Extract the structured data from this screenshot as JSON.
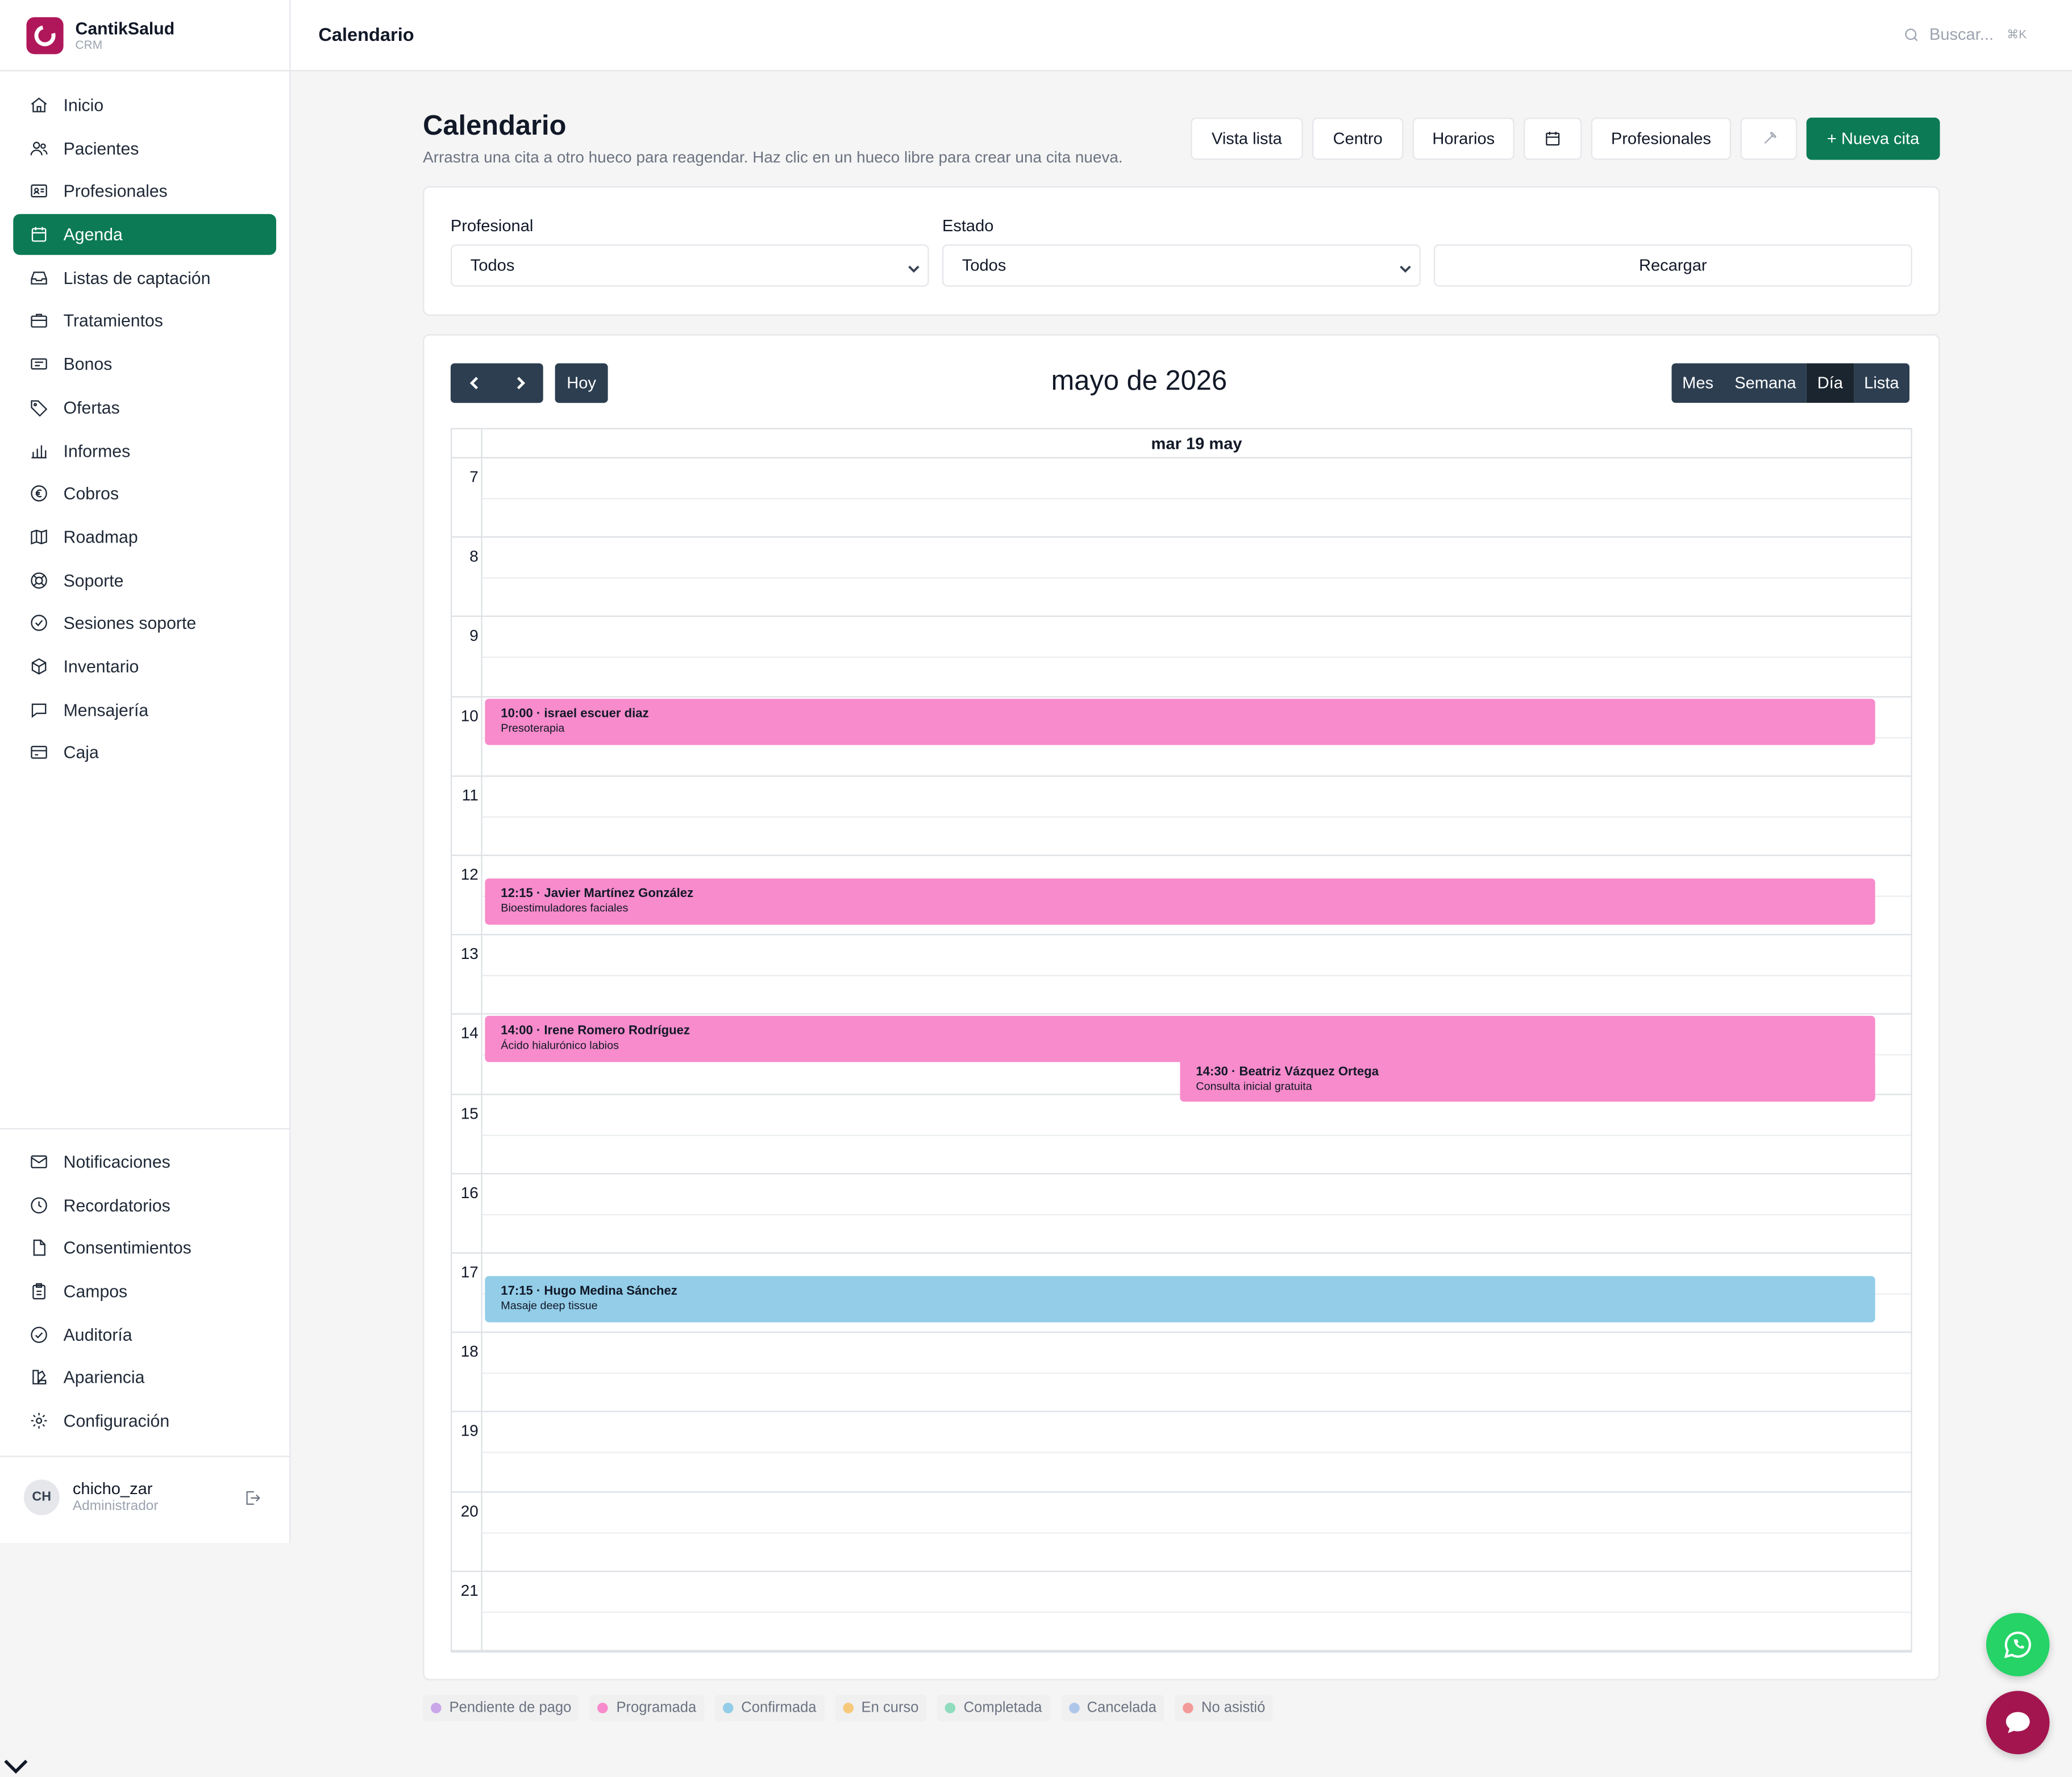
{
  "brand": {
    "name": "CantikSalud",
    "sub": "CRM"
  },
  "sidebar": {
    "items": [
      {
        "label": "Inicio",
        "icon": "home-icon"
      },
      {
        "label": "Pacientes",
        "icon": "users-icon"
      },
      {
        "label": "Profesionales",
        "icon": "id-card-icon"
      },
      {
        "label": "Agenda",
        "icon": "calendar-icon",
        "active": true
      },
      {
        "label": "Listas de captación",
        "icon": "inbox-icon"
      },
      {
        "label": "Tratamientos",
        "icon": "briefcase-icon"
      },
      {
        "label": "Bonos",
        "icon": "ticket-icon"
      },
      {
        "label": "Ofertas",
        "icon": "tag-icon"
      },
      {
        "label": "Informes",
        "icon": "bar-chart-icon"
      },
      {
        "label": "Cobros",
        "icon": "euro-icon"
      },
      {
        "label": "Roadmap",
        "icon": "map-icon"
      },
      {
        "label": "Soporte",
        "icon": "lifebuoy-icon"
      },
      {
        "label": "Sesiones soporte",
        "icon": "check-circle-icon"
      },
      {
        "label": "Inventario",
        "icon": "box-icon"
      },
      {
        "label": "Mensajería",
        "icon": "chat-icon"
      },
      {
        "label": "Caja",
        "icon": "credit-card-icon"
      }
    ],
    "bottom_items": [
      {
        "label": "Notificaciones",
        "icon": "mail-icon"
      },
      {
        "label": "Recordatorios",
        "icon": "clock-icon"
      },
      {
        "label": "Consentimientos",
        "icon": "file-icon"
      },
      {
        "label": "Campos",
        "icon": "clipboard-icon"
      },
      {
        "label": "Auditoría",
        "icon": "badge-check-icon"
      },
      {
        "label": "Apariencia",
        "icon": "palette-icon"
      },
      {
        "label": "Configuración",
        "icon": "gear-icon"
      }
    ]
  },
  "user": {
    "initials": "CH",
    "name": "chicho_zar",
    "role": "Administrador"
  },
  "topbar": {
    "title": "Calendario",
    "search_placeholder": "Buscar...",
    "shortcut": "⌘K"
  },
  "page": {
    "title": "Calendario",
    "subtitle": "Arrastra una cita a otro hueco para reagendar. Haz clic en un hueco libre para crear una cita nueva."
  },
  "toolbar": {
    "list_view": "Vista lista",
    "center": "Centro",
    "schedules": "Horarios",
    "professionals": "Profesionales",
    "new_appointment": "+ Nueva cita"
  },
  "filters": {
    "professional_label": "Profesional",
    "professional_value": "Todos",
    "status_label": "Estado",
    "status_value": "Todos",
    "reload": "Recargar"
  },
  "calendar": {
    "today": "Hoy",
    "title": "mayo de 2026",
    "views": [
      "Mes",
      "Semana",
      "Día",
      "Lista"
    ],
    "active_view": "Día",
    "day_header": "mar 19 may",
    "hours": [
      "7",
      "8",
      "9",
      "10",
      "11",
      "12",
      "13",
      "14",
      "15",
      "16",
      "17",
      "18",
      "19",
      "20",
      "21"
    ],
    "events": [
      {
        "time": "10:00",
        "title": "10:00 · israel escuer diaz",
        "subtitle": "Presoterapia",
        "color": "#f78bcb",
        "start": 10.0,
        "end": 10.58,
        "col": "full"
      },
      {
        "time": "12:15",
        "title": "12:15 · Javier Martínez González",
        "subtitle": "Bioestimuladores faciales",
        "color": "#f78bcb",
        "start": 12.26,
        "end": 12.84,
        "col": "full"
      },
      {
        "time": "14:00",
        "title": "14:00 · Irene Romero Rodríguez",
        "subtitle": "Ácido hialurónico labios",
        "color": "#f78bcb",
        "start": 14.0,
        "end": 14.58,
        "col": "full"
      },
      {
        "time": "14:30",
        "title": "14:30 · Beatriz Vázquez Ortega",
        "subtitle": "Consulta inicial gratuita",
        "color": "#f78bcb",
        "start": 14.5,
        "end": 15.08,
        "col": "right"
      },
      {
        "time": "17:15",
        "title": "17:15 · Hugo Medina Sánchez",
        "subtitle": "Masaje deep tissue",
        "color": "#93cde8",
        "start": 17.26,
        "end": 17.84,
        "col": "full"
      }
    ]
  },
  "legend": [
    {
      "label": "Pendiente de pago",
      "color": "#c9a7e8"
    },
    {
      "label": "Programada",
      "color": "#f78bcb"
    },
    {
      "label": "Confirmada",
      "color": "#93cde8"
    },
    {
      "label": "En curso",
      "color": "#f6c97a"
    },
    {
      "label": "Completada",
      "color": "#8fdcbf"
    },
    {
      "label": "Cancelada",
      "color": "#aec6ea"
    },
    {
      "label": "No asistió",
      "color": "#f29a9a"
    }
  ],
  "colors": {
    "accent": "#0b7a55",
    "brand": "#b0175a",
    "calendar_dark": "#2c3e50",
    "whatsapp": "#25d366",
    "chat": "#a3154f"
  }
}
